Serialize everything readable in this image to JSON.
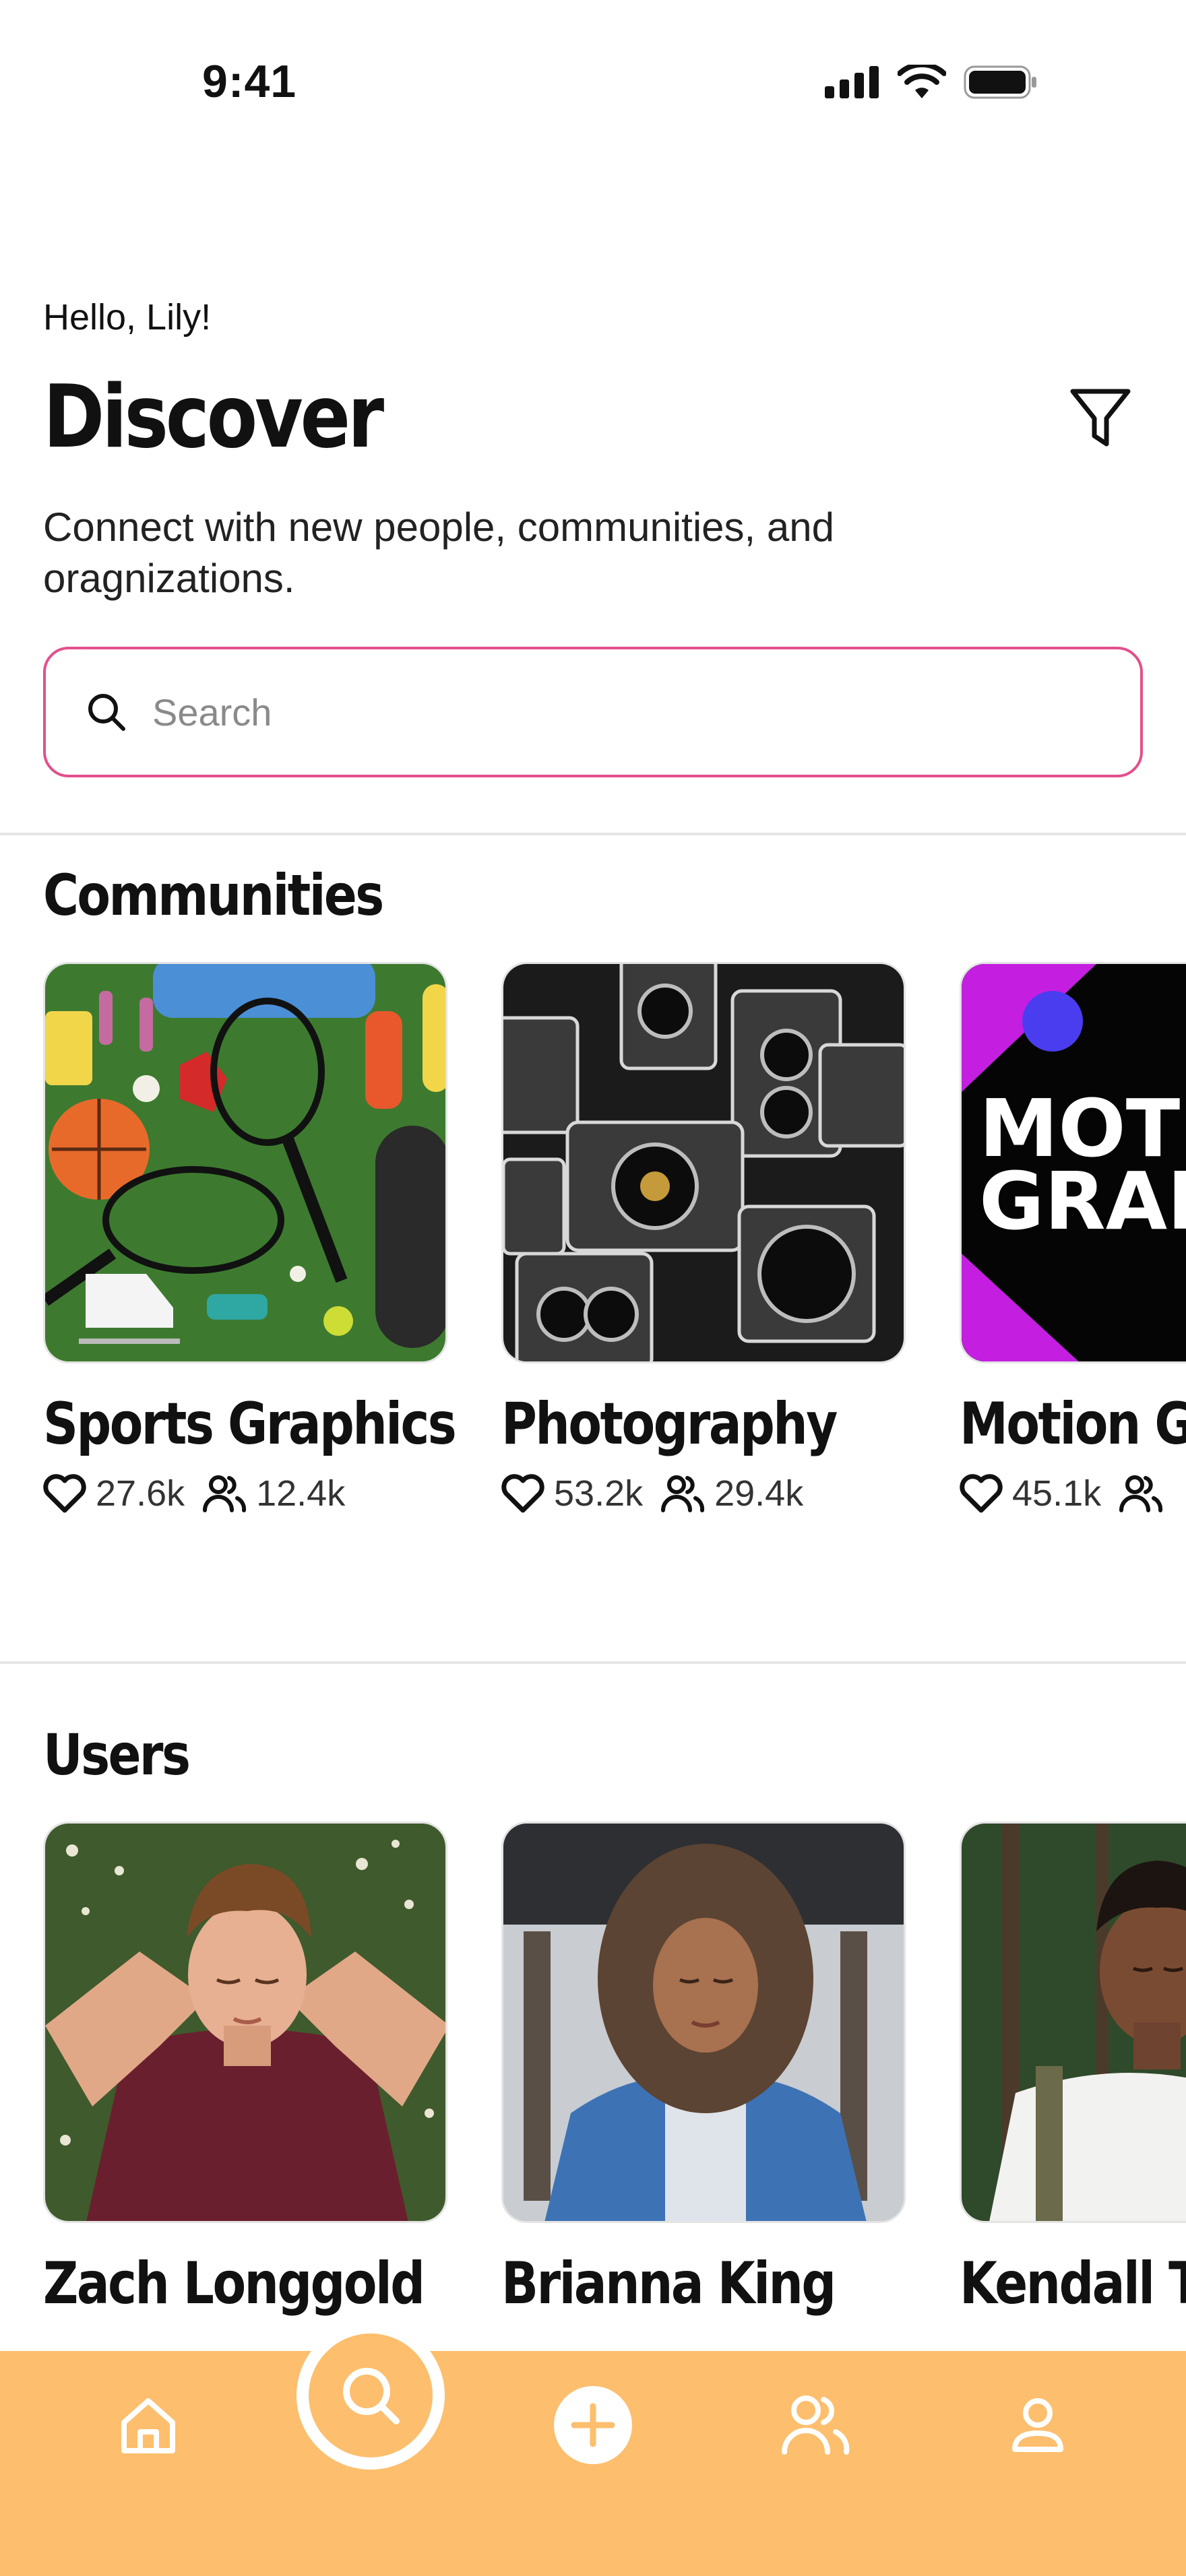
{
  "status_bar": {
    "time": "9:41"
  },
  "header": {
    "greeting": "Hello, Lily!",
    "title": "Discover",
    "subtitle": "Connect with new people, communities, and oragnizations."
  },
  "search": {
    "placeholder": "Search",
    "value": ""
  },
  "communities": {
    "title": "Communities",
    "items": [
      {
        "name": "Sports Graphics",
        "likes": "27.6k",
        "members": "12.4k"
      },
      {
        "name": "Photography",
        "likes": "53.2k",
        "members": "29.4k"
      },
      {
        "name": "Motion Graphics",
        "likes": "45.1k",
        "members": "",
        "image_text": "MOTION GRAPHICS"
      }
    ]
  },
  "users": {
    "title": "Users",
    "items": [
      {
        "name": "Zach Longgold"
      },
      {
        "name": "Brianna King"
      },
      {
        "name": "Kendall Thomas"
      }
    ]
  },
  "tabbar": {
    "items": [
      "home-icon",
      "search-icon",
      "plus-icon",
      "users-icon",
      "profile-icon"
    ],
    "active": "search-icon"
  },
  "colors": {
    "accent_pink": "#e2508b",
    "tabbar": "#fdbe6d",
    "motion_purple": "#c41fe0"
  }
}
